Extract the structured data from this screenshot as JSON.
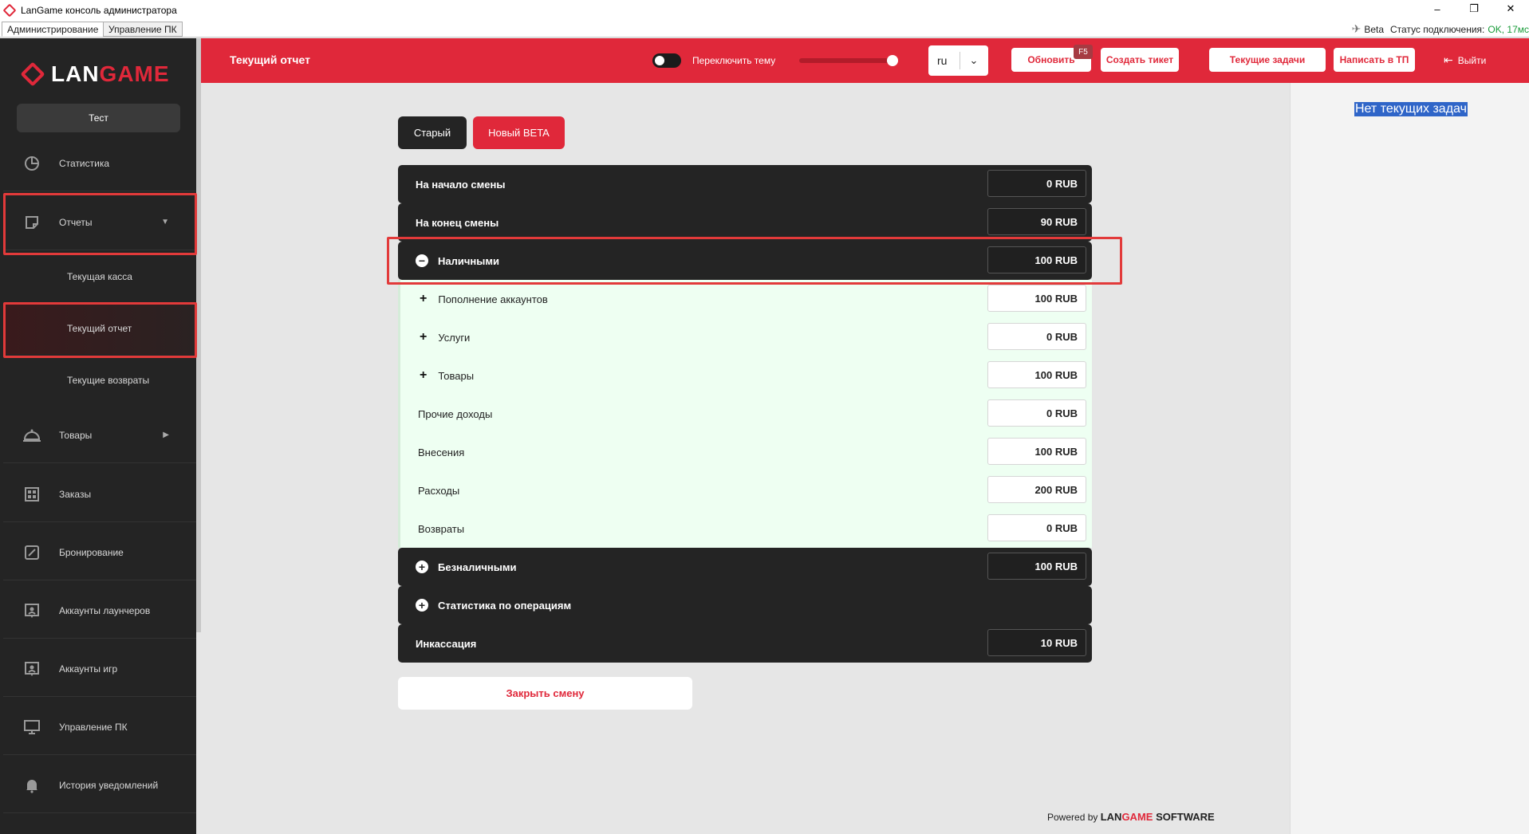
{
  "window": {
    "title": "LanGame консоль администратора",
    "tabs": [
      "Администрирование",
      "Управление ПК"
    ],
    "beta": "Beta",
    "status_label": "Статус подключения:",
    "status_value": "OK, 17мс",
    "controls": {
      "minimize": "–",
      "maximize": "❐",
      "close": "✕"
    }
  },
  "sidebar": {
    "logo_text_a": "LAN",
    "logo_text_b": "GAME",
    "user": "Тест",
    "items": [
      {
        "label": "Статистика",
        "icon": "pie-chart-icon"
      },
      {
        "label": "Отчеты",
        "icon": "note-icon"
      },
      {
        "label": "Товары",
        "icon": "cloche-icon"
      },
      {
        "label": "Заказы",
        "icon": "grid-icon"
      },
      {
        "label": "Бронирование",
        "icon": "pencil-square-icon"
      },
      {
        "label": "Аккаунты лаунчеров",
        "icon": "user-card-icon"
      },
      {
        "label": "Аккаунты игр",
        "icon": "user-card-icon"
      },
      {
        "label": "Управление ПК",
        "icon": "monitor-icon"
      },
      {
        "label": "История уведомлений",
        "icon": "bell-icon"
      }
    ],
    "subitems": [
      "Текущая касса",
      "Текущий отчет",
      "Текущие возвраты"
    ]
  },
  "header": {
    "title": "Текущий отчет",
    "theme_toggle_label": "Переключить тему",
    "language": "ru",
    "refresh": "Обновить",
    "refresh_hotkey": "F5",
    "create_ticket": "Создать тикет",
    "current_tasks": "Текущие задачи",
    "write_support": "Написать в ТП",
    "logout": "Выйти",
    "accent": "#e0283a"
  },
  "right_panel": {
    "empty_text": "Нет текущих задач"
  },
  "main": {
    "btn_old": "Старый",
    "btn_new": "Новый BETA",
    "rows": [
      {
        "label": "На начало смены",
        "value": "0 RUB"
      },
      {
        "label": "На конец смены",
        "value": "90 RUB"
      },
      {
        "label": "Наличными",
        "value": "100 RUB"
      },
      {
        "label": "Пополнение аккаунтов",
        "value": "100 RUB"
      },
      {
        "label": "Услуги",
        "value": "0 RUB"
      },
      {
        "label": "Товары",
        "value": "100 RUB"
      },
      {
        "label": "Прочие доходы",
        "value": "0 RUB"
      },
      {
        "label": "Внесения",
        "value": "100 RUB"
      },
      {
        "label": "Расходы",
        "value": "200 RUB"
      },
      {
        "label": "Возвраты",
        "value": "0 RUB"
      },
      {
        "label": "Безналичными",
        "value": "100 RUB"
      },
      {
        "label": "Статистика по операциям",
        "value": ""
      },
      {
        "label": "Инкассация",
        "value": "10 RUB"
      }
    ],
    "close_shift": "Закрыть смену",
    "powered_prefix": "Powered by",
    "powered_brand_a": "LAN",
    "powered_brand_b": "GAME",
    "powered_suffix": "SOFTWARE"
  }
}
